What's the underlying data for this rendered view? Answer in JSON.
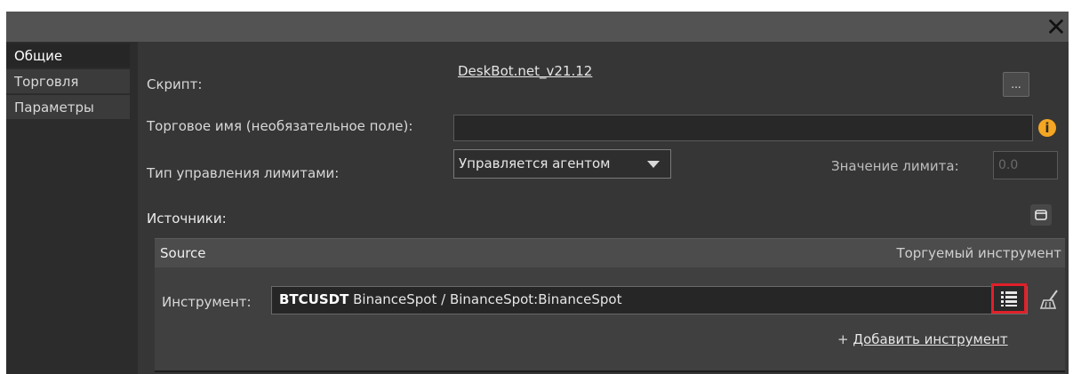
{
  "window": {
    "close_glyph": "✕"
  },
  "sidebar": {
    "tabs": [
      {
        "label": "Общие",
        "active": true
      },
      {
        "label": "Торговля",
        "active": false
      },
      {
        "label": "Параметры",
        "active": false
      }
    ]
  },
  "general": {
    "script_label": "Скрипт:",
    "script_value": "DeskBot.net_v21.12",
    "browse_button": "...",
    "trade_name_label": "Торговое имя (необязательное поле):",
    "trade_name_value": "",
    "info_icon": "info-icon",
    "limit_type_label": "Тип управления лимитами:",
    "limit_type_value": "Управляется агентом",
    "limit_value_label": "Значение лимита:",
    "limit_value_placeholder": "0.0",
    "sources_label": "Источники:"
  },
  "sources_table": {
    "columns": [
      "Source",
      "Торгуемый инструмент"
    ],
    "instrument_label": "Инструмент:",
    "instrument_symbol": "BTCUSDT",
    "instrument_rest": " BinanceSpot / BinanceSpot:BinanceSpot",
    "add_instrument_prefix": "+ ",
    "add_instrument_link": "Добавить инструмент"
  },
  "colors": {
    "background": "#2c2c2c",
    "content": "#363636",
    "accent_warning": "#f5a623",
    "highlight_box": "#e0202a"
  }
}
